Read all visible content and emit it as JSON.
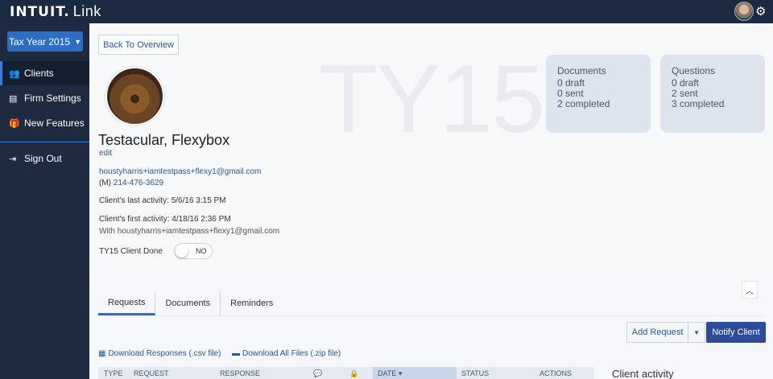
{
  "topbar": {
    "brand": "INTUIT.",
    "app_name": "Link",
    "avatar_icon": "user-avatar",
    "settings_icon": "gear-icon"
  },
  "sidebar": {
    "tax_year": "Tax Year 2015",
    "items": [
      {
        "label": "Clients",
        "icon": "users-icon"
      },
      {
        "label": "Firm Settings",
        "icon": "building-icon"
      },
      {
        "label": "New Features",
        "icon": "gift-icon"
      },
      {
        "label": "Sign Out",
        "icon": "sign-out-icon"
      }
    ]
  },
  "profile": {
    "back_label": "Back To Overview",
    "watermark": "TY15",
    "name": "Testacular, Flexybox",
    "edit_label": "edit",
    "email": "houstyharris+iamtestpass+flexy1@gmail.com",
    "phone_prefix": "(M)",
    "phone": "214-476-3629",
    "last_activity": "Client's last activity: 5/6/16 3:15 PM",
    "first_activity": "Client's first activity: 4/18/16 2:36 PM",
    "with_email": "With houstyharris+iamtestpass+flexy1@gmail.com",
    "done_label": "TY15 Client Done",
    "done_toggle": "NO"
  },
  "cards": {
    "documents": {
      "title": "Documents",
      "draft": "0 draft",
      "sent": "0 sent",
      "completed": "2 completed"
    },
    "questions": {
      "title": "Questions",
      "draft": "0 draft",
      "sent": "2 sent",
      "completed": "3 completed"
    }
  },
  "tabs": [
    "Requests",
    "Documents",
    "Reminders"
  ],
  "actions": {
    "add_request": "Add Request",
    "notify_client": "Notify Client"
  },
  "downloads": {
    "responses": "Download Responses (.csv file)",
    "files": "Download All Files (.zip file)"
  },
  "table": {
    "headers": {
      "type": "TYPE",
      "request": "REQUEST",
      "response": "RESPONSE",
      "date": "DATE",
      "status": "STATUS",
      "actions": "ACTIONS"
    }
  },
  "activity": {
    "title": "Client activity"
  }
}
